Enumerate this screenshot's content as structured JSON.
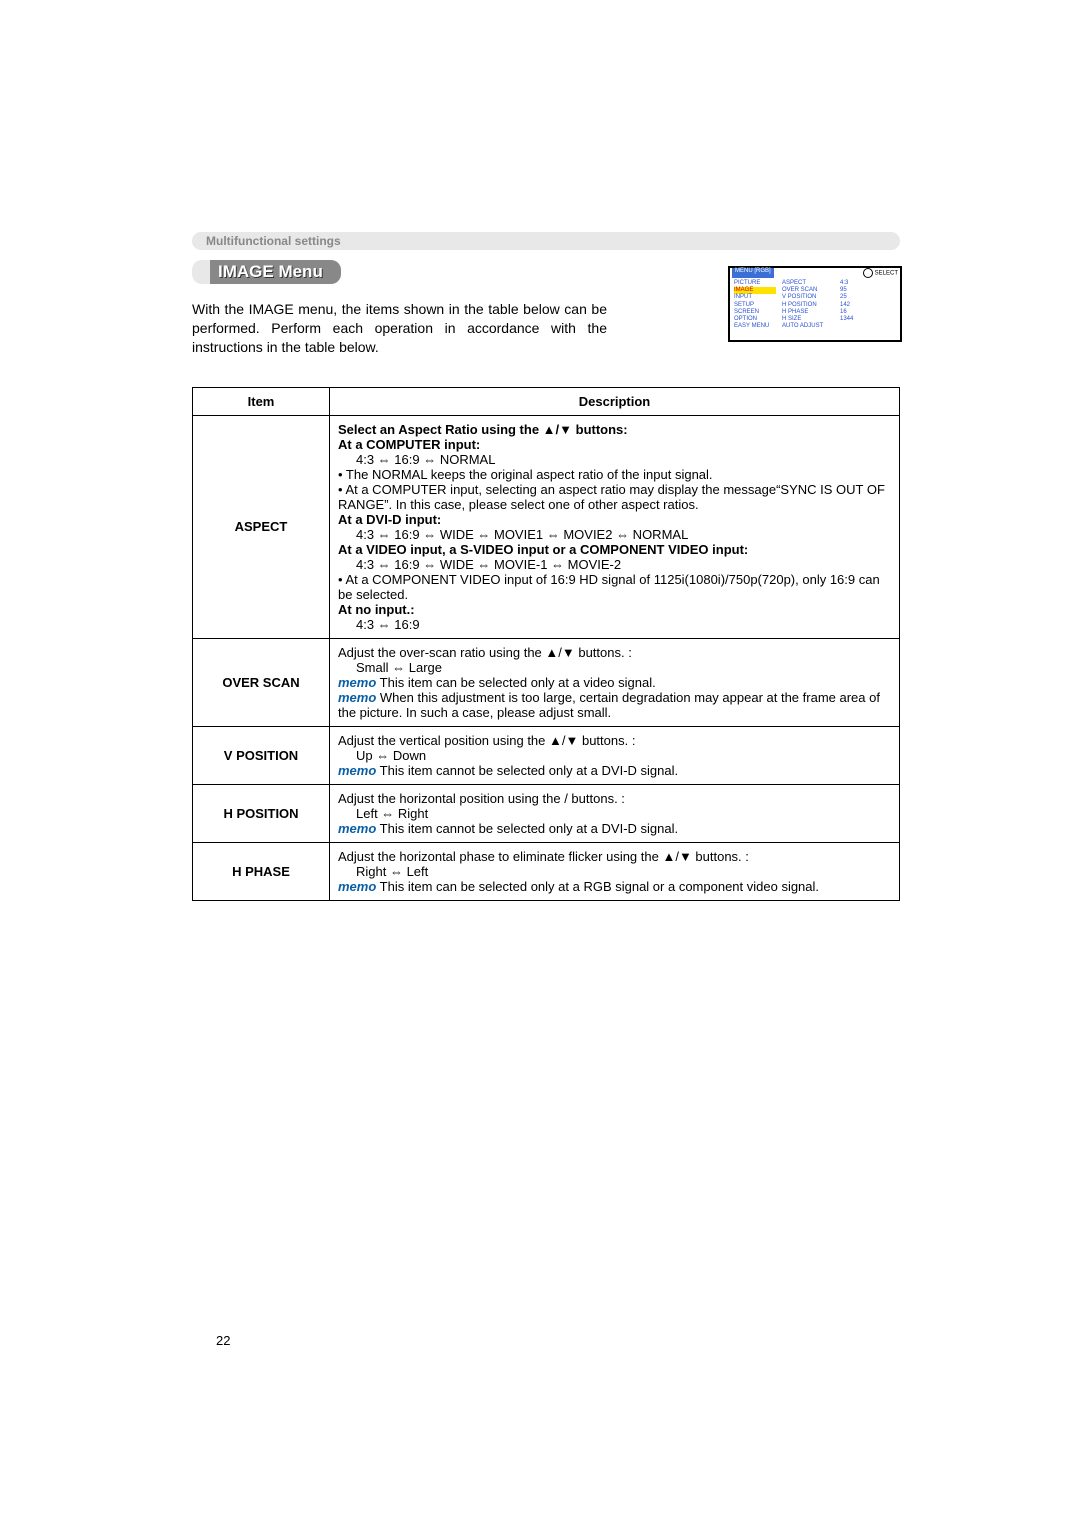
{
  "section_label": "Multifunctional settings",
  "title": "IMAGE Menu",
  "intro": "With the IMAGE menu, the items shown in the table below can be performed. Perform each operation in accordance with the instructions in the table below.",
  "osd": {
    "header_left": "MENU [RGB]",
    "header_right": "SELECT",
    "rows": [
      {
        "c1": "PICTURE",
        "c2": "ASPECT",
        "c3": "4:3",
        "hl": false
      },
      {
        "c1": "IMAGE",
        "c2": "OVER SCAN",
        "c3": "95",
        "hl": true
      },
      {
        "c1": "INPUT",
        "c2": "V POSITION",
        "c3": "25",
        "hl": false
      },
      {
        "c1": "SETUP",
        "c2": "H POSITION",
        "c3": "142",
        "hl": false
      },
      {
        "c1": "SCREEN",
        "c2": "H PHASE",
        "c3": "16",
        "hl": false
      },
      {
        "c1": "OPTION",
        "c2": "H SIZE",
        "c3": "1344",
        "hl": false
      },
      {
        "c1": "EASY MENU",
        "c2": "AUTO ADJUST",
        "c3": "",
        "hl": false
      }
    ]
  },
  "table_header_item": "Item",
  "table_header_desc": "Description",
  "rows": {
    "aspect": {
      "item": "ASPECT",
      "l1": "Select an Aspect Ratio using the ▲/▼ buttons:",
      "l2": "At a COMPUTER input:",
      "l3": "4:3 ⇔ 16:9 ⇔ NORMAL",
      "l4": "• The NORMAL keeps the original aspect ratio of the input signal.",
      "l5": "• At a COMPUTER input, selecting an aspect ratio may display the message“SYNC IS OUT OF RANGE”. In this case, please select one of other aspect ratios.",
      "l6": "At a DVI-D input:",
      "l7": "4:3 ⇔ 16:9 ⇔ WIDE ⇔ MOVIE1 ⇔ MOVIE2 ⇔ NORMAL",
      "l8": "At a VIDEO input, a S-VIDEO input or a COMPONENT VIDEO input:",
      "l9": "4:3 ⇔ 16:9 ⇔ WIDE ⇔ MOVIE-1 ⇔ MOVIE-2",
      "l10": "• At a COMPONENT VIDEO input of 16:9 HD signal of 1125i(1080i)/750p(720p), only 16:9 can be selected.",
      "l11": "At no input.:",
      "l12": "4:3 ⇔ 16:9"
    },
    "overscan": {
      "item": "OVER SCAN",
      "l1": "Adjust the over-scan ratio using the ▲/▼ buttons. :",
      "l2": "Small ⇔ Large",
      "memo1": "memo",
      "l3": "  This item can be selected only at a video signal.",
      "memo2": "memo",
      "l4": "  When this adjustment is too large, certain degradation may appear at the frame area of the picture. In such a case, please adjust small."
    },
    "vpos": {
      "item": "V POSITION",
      "l1": "Adjust the vertical position using the ▲/▼ buttons. :",
      "l2": "Up ⇔ Down",
      "memo": "memo",
      "l3": "  This item cannot be selected only at a DVI-D signal."
    },
    "hpos": {
      "item": "H POSITION",
      "l1": "Adjust the horizontal position using the / buttons. :",
      "l2": "Left ⇔ Right",
      "memo": "memo",
      "l3": "  This item cannot be selected only at a DVI-D signal."
    },
    "hphase": {
      "item": "H PHASE",
      "l1": "Adjust the horizontal phase to eliminate flicker using the ▲/▼ buttons. :",
      "l2": "Right ⇔ Left",
      "memo": "memo",
      "l3": "  This item can be selected only at a RGB signal or a component video signal."
    }
  },
  "page_number": "22"
}
